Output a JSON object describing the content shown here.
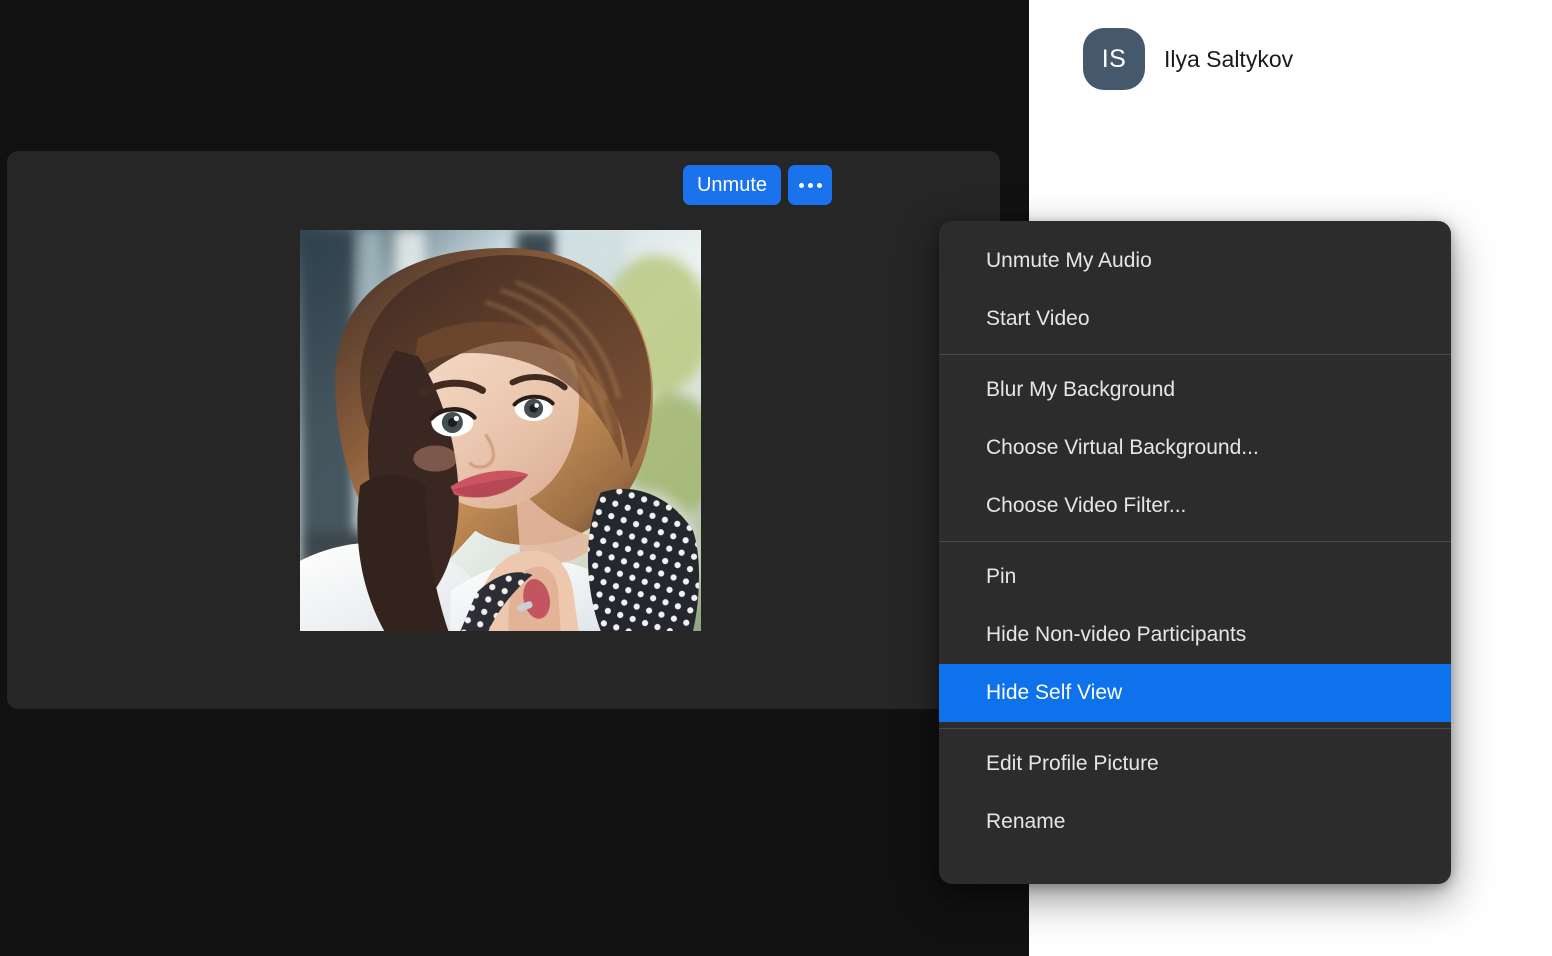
{
  "theme": {
    "page_background": "#111111",
    "tile_background": "#262626",
    "panel_background": "#ffffff",
    "accent_blue": "#1a72ec",
    "menu_background": "#2c2c2c",
    "menu_text": "#e6e6e6",
    "avatar_background": "#46596c",
    "separator": "#4a4a4a"
  },
  "participant": {
    "initials": "IS",
    "name": "Ilya Saltykov",
    "avatar_icon": "avatar-initials"
  },
  "video_tile": {
    "self_view_label": "self-view-video",
    "photo_alt": "portrait-photo-of-woman-with-auburn-bob-haircut-and-polka-dot-scarf",
    "controls": {
      "unmute_label": "Unmute",
      "more_icon": "more-options-ellipsis-icon"
    }
  },
  "context_menu": {
    "selected_item": "Hide Self View",
    "groups": [
      {
        "items": [
          {
            "label": "Unmute My Audio",
            "selected": false
          },
          {
            "label": "Start Video",
            "selected": false
          }
        ]
      },
      {
        "items": [
          {
            "label": "Blur My Background",
            "selected": false
          },
          {
            "label": "Choose Virtual Background...",
            "selected": false
          },
          {
            "label": "Choose Video Filter...",
            "selected": false
          }
        ]
      },
      {
        "items": [
          {
            "label": "Pin",
            "selected": false
          },
          {
            "label": "Hide Non-video Participants",
            "selected": false
          },
          {
            "label": "Hide Self View",
            "selected": true
          }
        ]
      },
      {
        "items": [
          {
            "label": "Edit Profile Picture",
            "selected": false
          },
          {
            "label": "Rename",
            "selected": false
          }
        ]
      }
    ]
  }
}
